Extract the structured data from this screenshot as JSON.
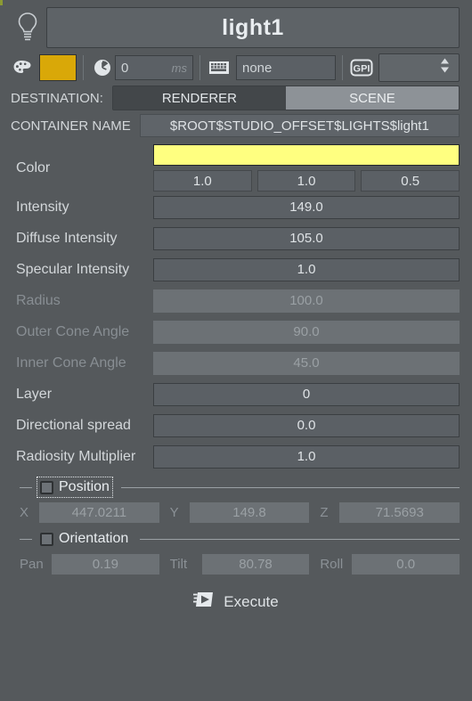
{
  "accent_colors": {
    "panel_bg": "#55595C",
    "field_bg": "#5B6065",
    "field_disabled_bg": "#6C7175",
    "swatch": "#D9A808",
    "color_bar": "#FFFF80",
    "segment_selected": "#43474A",
    "segment_unselected": "#8D9297",
    "corner_accent": "#8C9A33"
  },
  "header": {
    "icon": "light-bulb-icon",
    "name": "light1"
  },
  "toolbar": {
    "palette_icon": "color-palette-icon",
    "swatch_color": "#D9A808",
    "clock_icon": "clock-icon",
    "delay_value": "0",
    "delay_unit": "ms",
    "keyboard_icon": "keyboard-icon",
    "shortcut_value": "none",
    "gpi_icon": "gpi-icon",
    "gpi_value": ""
  },
  "destination": {
    "label": "DESTINATION:",
    "options": [
      "RENDERER",
      "SCENE"
    ],
    "selected": "RENDERER"
  },
  "container": {
    "label": "CONTAINER NAME",
    "value": "$ROOT$STUDIO_OFFSET$LIGHTS$light1"
  },
  "color": {
    "label": "Color",
    "bar_color": "#FFFF80",
    "channels": [
      "1.0",
      "1.0",
      "0.5"
    ]
  },
  "params": [
    {
      "label": "Intensity",
      "value": "149.0",
      "disabled": false
    },
    {
      "label": "Diffuse Intensity",
      "value": "105.0",
      "disabled": false
    },
    {
      "label": "Specular Intensity",
      "value": "1.0",
      "disabled": false
    },
    {
      "label": "Radius",
      "value": "100.0",
      "disabled": true
    },
    {
      "label": "Outer Cone Angle",
      "value": "90.0",
      "disabled": true
    },
    {
      "label": "Inner Cone Angle",
      "value": "45.0",
      "disabled": true
    },
    {
      "label": "Layer",
      "value": "0",
      "disabled": false
    },
    {
      "label": "Directional spread",
      "value": "0.0",
      "disabled": false
    },
    {
      "label": "Radiosity Multiplier",
      "value": "1.0",
      "disabled": false
    }
  ],
  "position": {
    "label": "Position",
    "checked": false,
    "focused": true,
    "axes": [
      {
        "name": "X",
        "value": "447.0211"
      },
      {
        "name": "Y",
        "value": "149.8"
      },
      {
        "name": "Z",
        "value": "71.5693"
      }
    ]
  },
  "orientation": {
    "label": "Orientation",
    "checked": false,
    "focused": false,
    "axes": [
      {
        "name": "Pan",
        "value": "0.19"
      },
      {
        "name": "Tilt",
        "value": "80.78"
      },
      {
        "name": "Roll",
        "value": "0.0"
      }
    ]
  },
  "execute": {
    "icon": "execute-play-icon",
    "label": "Execute"
  }
}
